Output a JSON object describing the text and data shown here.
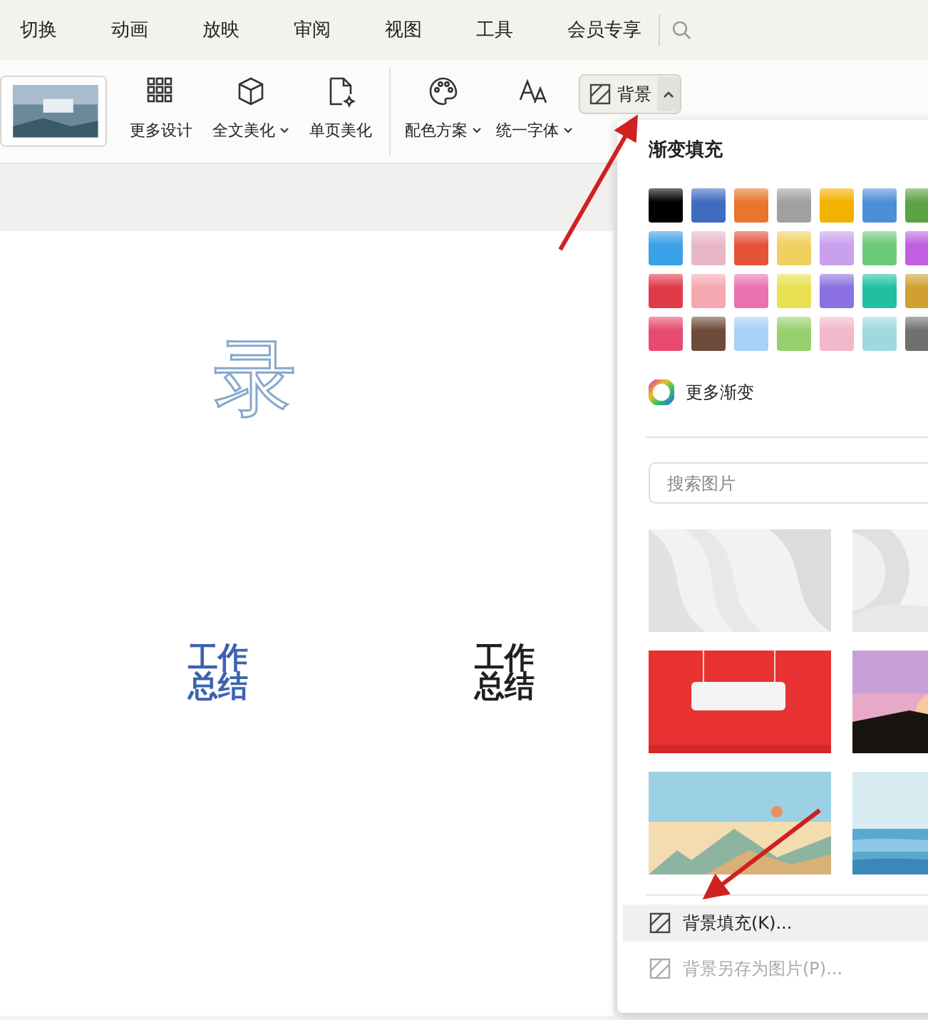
{
  "menu_tabs": [
    {
      "label": "切换"
    },
    {
      "label": "动画"
    },
    {
      "label": "放映"
    },
    {
      "label": "审阅"
    },
    {
      "label": "视图"
    },
    {
      "label": "工具"
    },
    {
      "label": "会员专享"
    }
  ],
  "ribbon": {
    "tools": [
      {
        "label": "更多设计",
        "kind": "grid",
        "dropdown": false
      },
      {
        "label": "全文美化",
        "kind": "cube",
        "dropdown": true
      },
      {
        "label": "单页美化",
        "kind": "page",
        "dropdown": false
      },
      {
        "label": "配色方案",
        "kind": "palette",
        "dropdown": true
      },
      {
        "label": "统一字体",
        "kind": "font",
        "dropdown": true
      }
    ],
    "background_button": {
      "label": "背景",
      "expanded": true
    }
  },
  "slide": {
    "outline_glyph": "录",
    "titles": [
      {
        "lines": [
          "工作",
          "总结"
        ],
        "color": "#3d62b0"
      },
      {
        "lines": [
          "工作",
          "总结"
        ],
        "color": "#1f1f1f"
      }
    ]
  },
  "background_panel": {
    "gradient_title": "渐变填充",
    "swatches": [
      {
        "color": "#000000"
      },
      {
        "color": "#3f6cbf"
      },
      {
        "color": "#e8762b"
      },
      {
        "color": "#a0a0a0"
      },
      {
        "color": "#f2b200"
      },
      {
        "color": "#4d8fd6"
      },
      {
        "color": "#5ba345"
      },
      {
        "color": "#3aa0e8"
      },
      {
        "color": "#e8b7c6"
      },
      {
        "color": "#e5523a"
      },
      {
        "color": "#f0d060"
      },
      {
        "color": "#c9a0ec"
      },
      {
        "color": "#6cc97a"
      },
      {
        "color": "#c060e0"
      },
      {
        "color": "#e03a48"
      },
      {
        "color": "#f5a8b0"
      },
      {
        "color": "#e872b0"
      },
      {
        "color": "#e8e050"
      },
      {
        "color": "#8a70e0"
      },
      {
        "color": "#20c0a0"
      },
      {
        "color": "#d0a030"
      },
      {
        "color": "#e84a70"
      },
      {
        "color": "#6e4a3a"
      },
      {
        "color": "#a8d0f8"
      },
      {
        "color": "#98d070"
      },
      {
        "color": "#f0b8c8"
      },
      {
        "color": "#a0d8e0"
      },
      {
        "color": "#707070"
      }
    ],
    "more_gradients": "更多渐变",
    "search": {
      "placeholder": "搜索图片"
    },
    "actions": [
      {
        "label": "背景填充(K)...",
        "disabled": false
      },
      {
        "label": "背景另存为图片(P)...",
        "disabled": true
      }
    ]
  }
}
